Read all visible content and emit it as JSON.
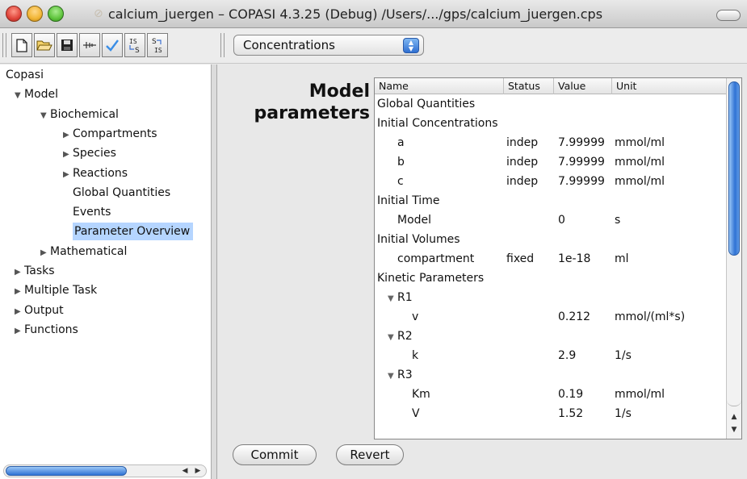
{
  "window": {
    "title": "calcium_juergen – COPASI 4.3.25 (Debug) /Users/.../gps/calcium_juergen.cps"
  },
  "toolbar": {
    "buttons": [
      {
        "name": "new-document-button",
        "icon": "new-document-icon"
      },
      {
        "name": "open-folder-button",
        "icon": "open-folder-icon"
      },
      {
        "name": "save-button",
        "icon": "save-icon"
      },
      {
        "name": "slider-button",
        "icon": "slider-icon"
      },
      {
        "name": "check-model-button",
        "icon": "checkmark-icon"
      },
      {
        "name": "initial-to-state-button",
        "label_top": "IS",
        "label_bottom": "S"
      },
      {
        "name": "state-to-initial-button",
        "label_top": "S",
        "label_bottom": "IS"
      }
    ],
    "combo": {
      "selected": "Concentrations"
    }
  },
  "tree": {
    "items": [
      {
        "label": "Copasi",
        "level": 0,
        "toggle": ""
      },
      {
        "label": "Model",
        "level": 1,
        "toggle": "▼"
      },
      {
        "label": "Biochemical",
        "level": 2,
        "toggle": "▼"
      },
      {
        "label": "Compartments",
        "level": 3,
        "toggle": "▶"
      },
      {
        "label": "Species",
        "level": 3,
        "toggle": "▶"
      },
      {
        "label": "Reactions",
        "level": 3,
        "toggle": "▶"
      },
      {
        "label": "Global Quantities",
        "level": 3,
        "toggle": ""
      },
      {
        "label": "Events",
        "level": 3,
        "toggle": ""
      },
      {
        "label": "Parameter Overview",
        "level": 3,
        "toggle": "",
        "selected": true
      },
      {
        "label": "Mathematical",
        "level": 2,
        "toggle": "▶"
      },
      {
        "label": "Tasks",
        "level": 1,
        "toggle": "▶"
      },
      {
        "label": "Multiple Task",
        "level": 1,
        "toggle": "▶"
      },
      {
        "label": "Output",
        "level": 1,
        "toggle": "▶"
      },
      {
        "label": "Functions",
        "level": 1,
        "toggle": "▶"
      }
    ]
  },
  "content": {
    "title_line1": "Model",
    "title_line2": "parameters",
    "table": {
      "headers": {
        "name": "Name",
        "status": "Status",
        "value": "Value",
        "unit": "Unit"
      },
      "rows": [
        {
          "name": "Global Quantities",
          "indent": 0,
          "toggle": "",
          "status": "",
          "value": "",
          "unit": ""
        },
        {
          "name": "Initial Concentrations",
          "indent": 0,
          "toggle": "",
          "status": "",
          "value": "",
          "unit": ""
        },
        {
          "name": "a",
          "indent": 2,
          "toggle": "",
          "status": "indep",
          "value": "7.99999",
          "unit": "mmol/ml"
        },
        {
          "name": "b",
          "indent": 2,
          "toggle": "",
          "status": "indep",
          "value": "7.99999",
          "unit": "mmol/ml"
        },
        {
          "name": "c",
          "indent": 2,
          "toggle": "",
          "status": "indep",
          "value": "7.99999",
          "unit": "mmol/ml"
        },
        {
          "name": "Initial Time",
          "indent": 0,
          "toggle": "",
          "status": "",
          "value": "",
          "unit": ""
        },
        {
          "name": "Model",
          "indent": 2,
          "toggle": "",
          "status": "",
          "value": "0",
          "unit": "s"
        },
        {
          "name": "Initial Volumes",
          "indent": 0,
          "toggle": "",
          "status": "",
          "value": "",
          "unit": ""
        },
        {
          "name": "compartment",
          "indent": 2,
          "toggle": "",
          "status": "fixed",
          "value": "1e-18",
          "unit": "ml"
        },
        {
          "name": "Kinetic Parameters",
          "indent": 0,
          "toggle": "",
          "status": "",
          "value": "",
          "unit": ""
        },
        {
          "name": "R1",
          "indent": 1,
          "toggle": "▼",
          "status": "",
          "value": "",
          "unit": ""
        },
        {
          "name": "v",
          "indent": 3,
          "toggle": "",
          "status": "",
          "value": "0.212",
          "unit": "mmol/(ml*s)"
        },
        {
          "name": "R2",
          "indent": 1,
          "toggle": "▼",
          "status": "",
          "value": "",
          "unit": ""
        },
        {
          "name": "k",
          "indent": 3,
          "toggle": "",
          "status": "",
          "value": "2.9",
          "unit": "1/s"
        },
        {
          "name": "R3",
          "indent": 1,
          "toggle": "▼",
          "status": "",
          "value": "",
          "unit": ""
        },
        {
          "name": "Km",
          "indent": 3,
          "toggle": "",
          "status": "",
          "value": "0.19",
          "unit": "mmol/ml"
        },
        {
          "name": "V",
          "indent": 3,
          "toggle": "",
          "status": "",
          "value": "1.52",
          "unit": "1/s"
        }
      ]
    },
    "buttons": {
      "commit": "Commit",
      "revert": "Revert"
    }
  }
}
